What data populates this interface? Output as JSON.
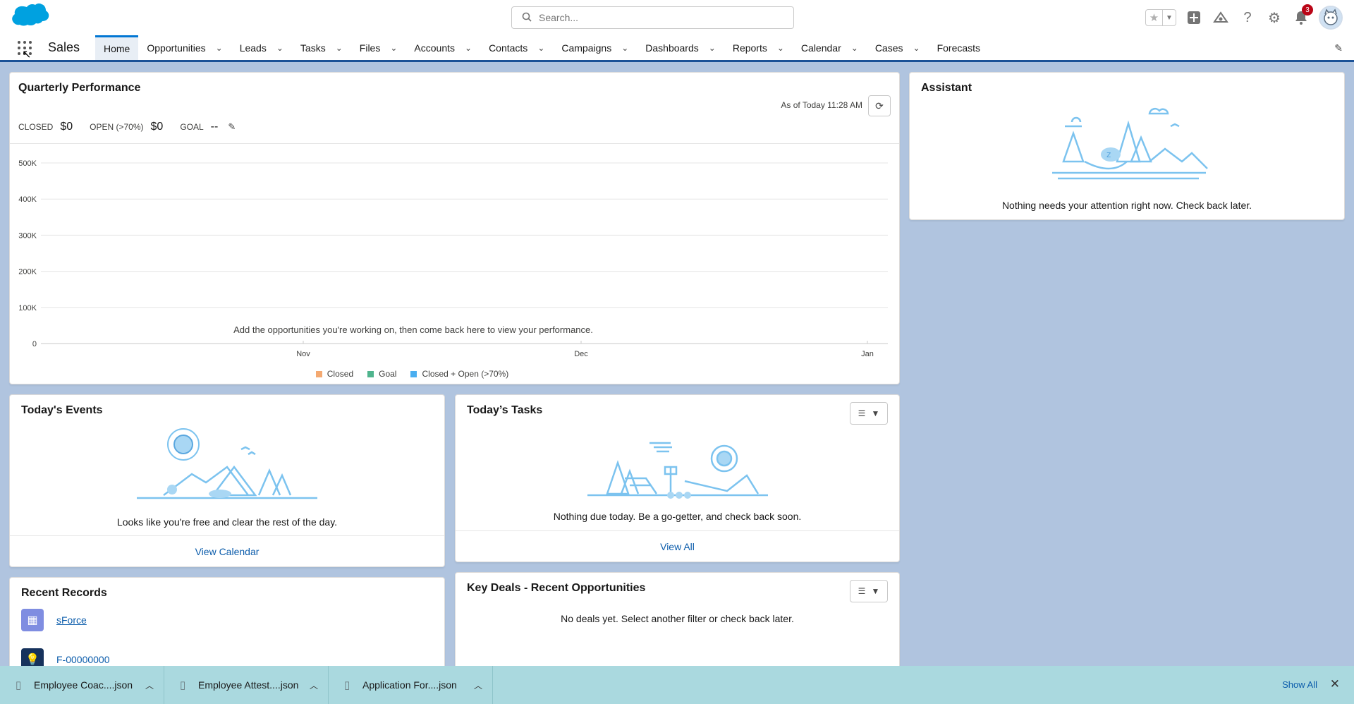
{
  "header": {
    "search_placeholder": "Search...",
    "notification_count": "3"
  },
  "nav": {
    "app_name": "Sales",
    "items": [
      {
        "label": "Home",
        "has_menu": false,
        "active": true
      },
      {
        "label": "Opportunities",
        "has_menu": true
      },
      {
        "label": "Leads",
        "has_menu": true
      },
      {
        "label": "Tasks",
        "has_menu": true
      },
      {
        "label": "Files",
        "has_menu": true
      },
      {
        "label": "Accounts",
        "has_menu": true
      },
      {
        "label": "Contacts",
        "has_menu": true
      },
      {
        "label": "Campaigns",
        "has_menu": true
      },
      {
        "label": "Dashboards",
        "has_menu": true
      },
      {
        "label": "Reports",
        "has_menu": true
      },
      {
        "label": "Calendar",
        "has_menu": true
      },
      {
        "label": "Cases",
        "has_menu": true
      },
      {
        "label": "Forecasts",
        "has_menu": false
      }
    ]
  },
  "quarterly": {
    "title": "Quarterly Performance",
    "as_of": "As of Today 11:28 AM",
    "closed_label": "CLOSED",
    "closed_value": "$0",
    "open_label": "OPEN (>70%)",
    "open_value": "$0",
    "goal_label": "GOAL",
    "goal_value": "--",
    "empty_message": "Add the opportunities you're working on, then come back here to view your performance."
  },
  "chart_data": {
    "type": "line",
    "x": [
      "Nov",
      "Dec",
      "Jan"
    ],
    "y_ticks": [
      "0",
      "100K",
      "200K",
      "300K",
      "400K",
      "500K"
    ],
    "ylim": [
      0,
      500000
    ],
    "series": [
      {
        "name": "Closed",
        "values": [],
        "color": "#f4a971"
      },
      {
        "name": "Goal",
        "values": [],
        "color": "#4fb48d"
      },
      {
        "name": "Closed + Open (>70%)",
        "values": [],
        "color": "#4aaef0"
      }
    ],
    "grid": true,
    "legend": "bottom"
  },
  "assistant": {
    "title": "Assistant",
    "message": "Nothing needs your attention right now. Check back later."
  },
  "events": {
    "title": "Today's Events",
    "message": "Looks like you're free and clear the rest of the day.",
    "link": "View Calendar"
  },
  "tasks": {
    "title": "Today’s Tasks",
    "message": "Nothing due today. Be a go-getter, and check back soon.",
    "link": "View All"
  },
  "recent": {
    "title": "Recent Records",
    "records": [
      {
        "name": "sForce",
        "icon": "account-icon",
        "color": "#7f8de1"
      },
      {
        "name": "F-00000000",
        "icon": "lightbulb-icon",
        "color": "#16325c"
      }
    ]
  },
  "deals": {
    "title": "Key Deals - Recent Opportunities",
    "message": "No deals yet. Select another filter or check back later."
  },
  "downloads": {
    "items": [
      "Employee Coac....json",
      "Employee Attest....json",
      "Application For....json"
    ],
    "show_all": "Show All"
  }
}
